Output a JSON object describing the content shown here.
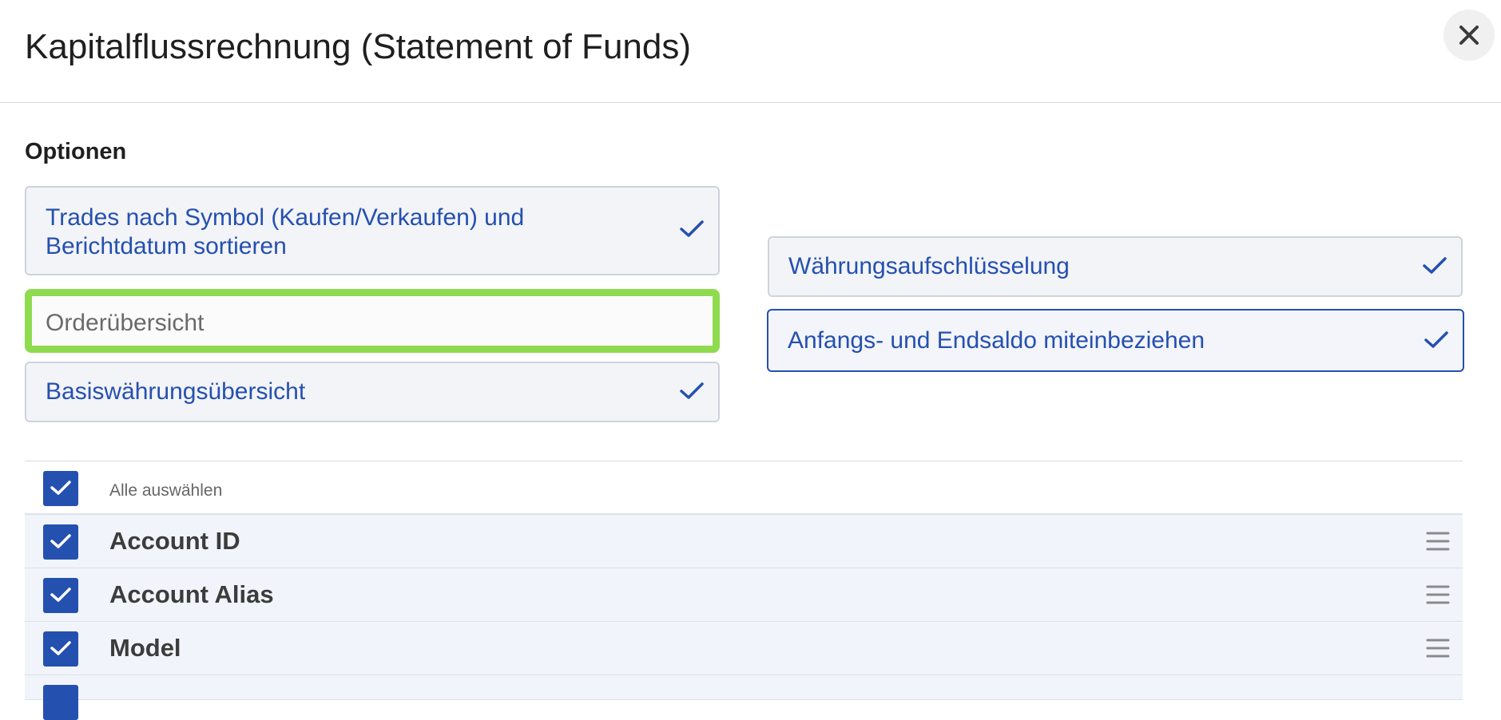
{
  "dialog": {
    "title": "Kapitalflussrechnung (Statement of Funds)",
    "close_icon": "close-icon"
  },
  "options": {
    "heading": "Optionen",
    "items": [
      {
        "label": "Trades nach Symbol (Kaufen/Verkaufen) und Berichtdatum sortieren",
        "selected": true
      },
      {
        "label": "Orderübersicht",
        "selected": false
      },
      {
        "label": "Basiswährungsübersicht",
        "selected": true
      },
      {
        "label": "Währungsaufschlüsselung",
        "selected": true
      },
      {
        "label": "Anfangs- und Endsaldo miteinbeziehen",
        "selected": true
      }
    ]
  },
  "fields": {
    "select_all_label": "Alle auswählen",
    "select_all_checked": true,
    "rows": [
      {
        "label": "Account ID",
        "checked": true
      },
      {
        "label": "Account Alias",
        "checked": true
      },
      {
        "label": "Model",
        "checked": true
      },
      {
        "label": "",
        "checked": true
      }
    ]
  },
  "colors": {
    "accent": "#2450b0",
    "highlight_border": "#8edb4f",
    "option_background": "#f3f4f8",
    "row_background": "#f1f4fa"
  }
}
